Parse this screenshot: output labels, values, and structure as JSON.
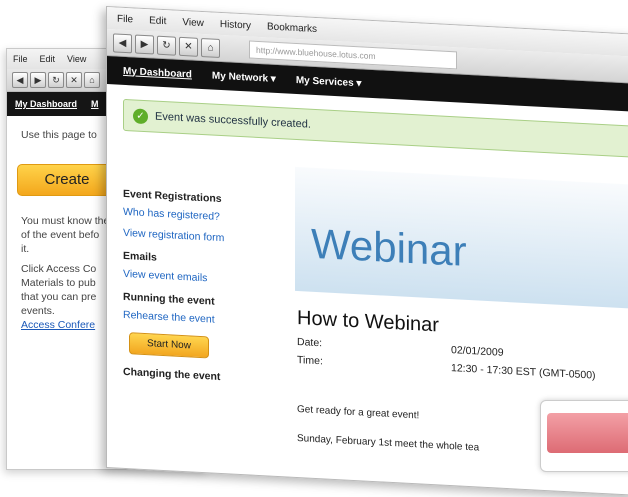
{
  "back_window": {
    "menu": [
      "File",
      "Edit",
      "View"
    ],
    "nav_dashboard": "My Dashboard",
    "nav_next": "M",
    "text1": "Use this page to",
    "create_button": "Create",
    "text2": "You must know the",
    "text3": "of the event befo",
    "text4": "it.",
    "text5": "Click Access Co",
    "text6": "Materials to pub",
    "text7": "that you can pre",
    "text8": "events.",
    "link": "Access Confere"
  },
  "front_window": {
    "menu": [
      "File",
      "Edit",
      "View",
      "History",
      "Bookmarks"
    ],
    "url": "http://www.bluehouse.lotus.com",
    "nav": {
      "dashboard": "My Dashboard",
      "network": "My Network ▾",
      "services": "My Services ▾"
    },
    "success_message": "Event was successfully created.",
    "sidebar": {
      "registrations_heading": "Event Registrations",
      "who_registered": "Who has registered?",
      "view_form": "View registration form",
      "emails_heading": "Emails",
      "view_emails": "View event emails",
      "running_heading": "Running the event",
      "rehearse": "Rehearse the event",
      "start_now": "Start Now",
      "changing_heading": "Changing the event"
    },
    "banner_title": "Webinar",
    "event": {
      "title": "How to Webinar",
      "date_label": "Date:",
      "date_value": "02/01/2009",
      "time_label": "Time:",
      "time_value": "12:30 - 17:30 EST (GMT-0500)",
      "message1": "Get ready for a great event!",
      "message2": "Sunday, February 1st meet the whole tea"
    }
  }
}
